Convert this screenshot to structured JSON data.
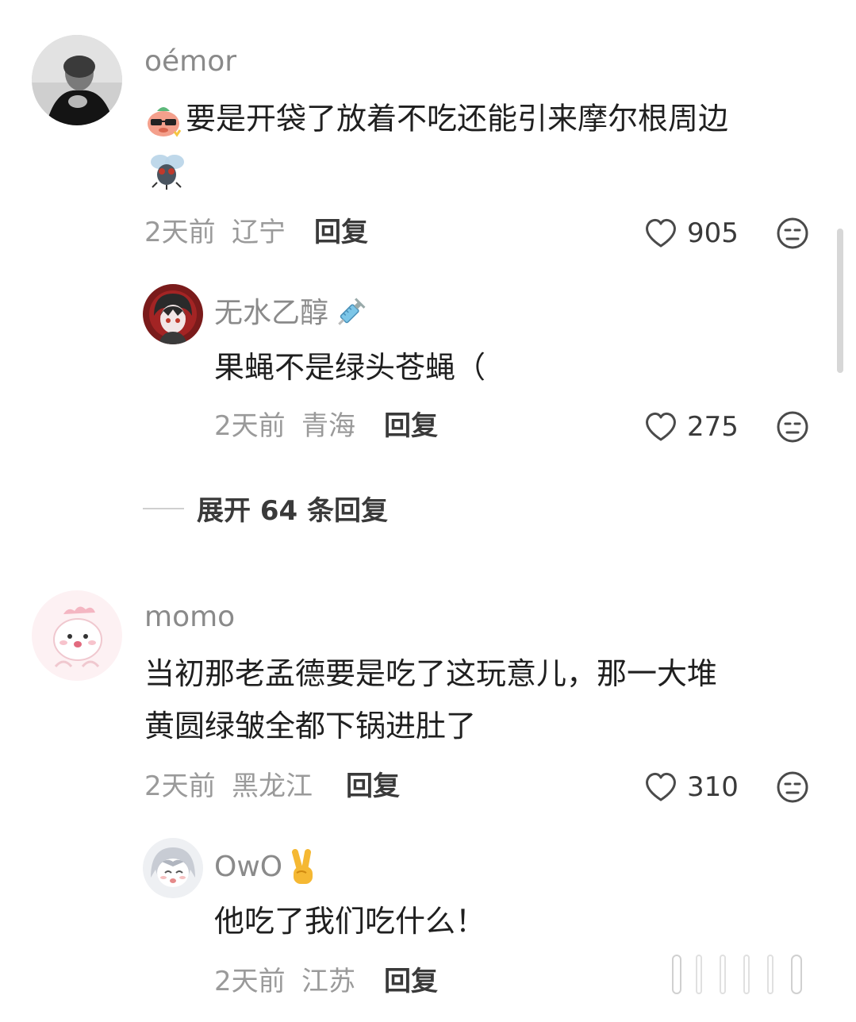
{
  "comments": [
    {
      "username": "oémor",
      "text_line1": "要是开袋了放着不吃还能引来摩尔根周边",
      "text_line2_emoji": "fly-emoji",
      "time": "2天前",
      "location": "辽宁",
      "reply_label": "回复",
      "likes": "905",
      "replies": [
        {
          "username": "无水乙醇",
          "username_emoji": "syringe-emoji",
          "text": "果蝇不是绿头苍蝇（",
          "time": "2天前",
          "location": "青海",
          "reply_label": "回复",
          "likes": "275"
        }
      ],
      "expand_label": "展开 64 条回复"
    },
    {
      "username": "momo",
      "text_line1": "当初那老孟德要是吃了这玩意儿，那一大堆",
      "text_line2": "黄圆绿皱全都下锅进肚了",
      "time": "2天前",
      "location": "黑龙江",
      "reply_label": "回复",
      "likes": "310",
      "replies": [
        {
          "username": "OwO",
          "username_emoji": "victory-hand-emoji",
          "text": "他吃了我们吃什么！",
          "time": "2天前",
          "location": "江苏",
          "reply_label": "回复"
        }
      ]
    }
  ],
  "icons": {
    "like": "heart-outline-icon",
    "dislike": "neutral-face-icon"
  },
  "colors": {
    "username": "#8a8a8a",
    "text": "#1f1f1f",
    "meta": "#9a9a9a",
    "action": "#3a3a3a"
  }
}
